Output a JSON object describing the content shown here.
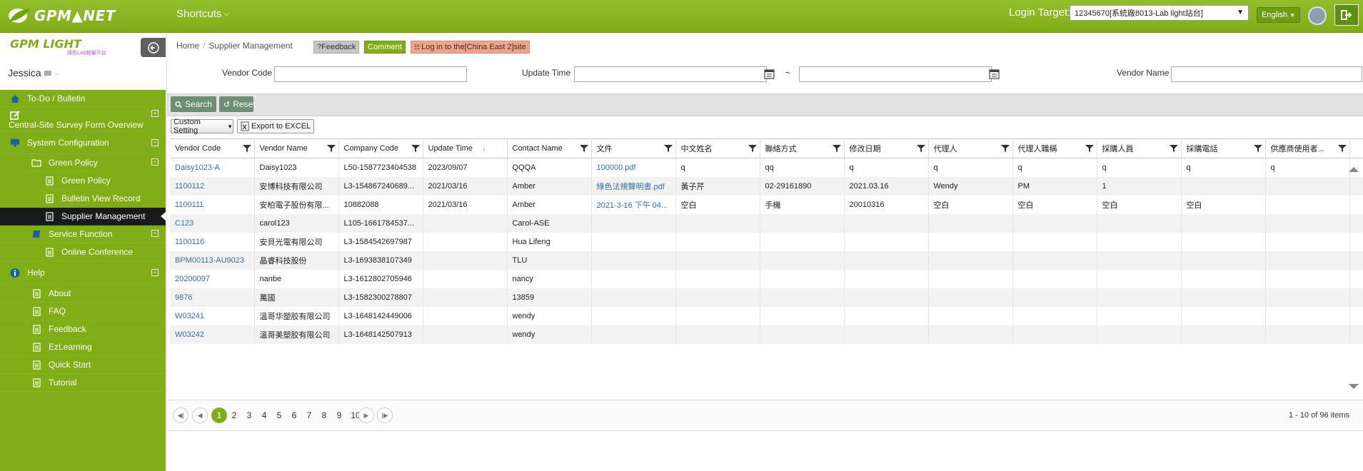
{
  "header": {
    "logo_text": "GPM▲NET",
    "shortcuts_label": "Shortcuts",
    "login_label": "Login Target:",
    "login_value": "12345670[系統廠8013-Lab light站台]",
    "language": "English"
  },
  "sidebar": {
    "logo_text": "GPM LIGHT",
    "logo_sub": "綠色Lab輕量平台",
    "user": "Jessica",
    "items": [
      {
        "label": "To-Do / Bulletin",
        "icon": "home-icon"
      },
      {
        "label": "Central-Site Survey Form Overview",
        "icon": "edit-icon"
      },
      {
        "label": "System Configuration",
        "icon": "monitor-icon"
      },
      {
        "label": "Green Policy",
        "icon": "folder-icon"
      },
      {
        "label": "Green Policy",
        "icon": "document-icon"
      },
      {
        "label": "Bulletin View Record",
        "icon": "document-icon"
      },
      {
        "label": "Supplier Management",
        "icon": "document-icon"
      },
      {
        "label": "Service Function",
        "icon": "book-icon"
      },
      {
        "label": "Online Conference",
        "icon": "document-icon"
      },
      {
        "label": "Help",
        "icon": "info-icon"
      },
      {
        "label": "About",
        "icon": "document-icon"
      },
      {
        "label": "FAQ",
        "icon": "document-icon"
      },
      {
        "label": "Feedback",
        "icon": "document-icon"
      },
      {
        "label": "EzLearning",
        "icon": "document-icon"
      },
      {
        "label": "Quick Start",
        "icon": "document-icon"
      },
      {
        "label": "Tutorial",
        "icon": "document-icon"
      }
    ]
  },
  "breadcrumb": {
    "home": "Home",
    "current": "Supplier Management"
  },
  "tags": {
    "feedback": "?Feedback",
    "comment": "Comment",
    "login_site": "Log in to the[China East 2]site"
  },
  "filters": {
    "vendor_code_label": "Vendor Code",
    "update_time_label": "Update Time",
    "range_sep": "~",
    "vendor_name_label": "Vendor Name"
  },
  "buttons": {
    "search": "Search",
    "reset": "Reset",
    "custom_setting": "Custom Setting",
    "export": "Export to EXCEL"
  },
  "table": {
    "columns": [
      "Vendor Code",
      "Vendor Name",
      "Company Code",
      "Update Time",
      "Contact Name",
      "文件",
      "中文姓名",
      "聯絡方式",
      "修改日期",
      "代理人",
      "代理人職稱",
      "採購人員",
      "採購電話",
      "供應商使用者..."
    ],
    "rows": [
      [
        "Daisy1023-A",
        "Daisy1023",
        "L50-1587723404538",
        "2023/09/07",
        "QQQA",
        "100000.pdf",
        "q",
        "qq",
        "q",
        "q",
        "q",
        "q",
        "q",
        "q"
      ],
      [
        "1100112",
        "安博科技有限公司",
        "L3-154867240689...",
        "2021/03/16",
        "Amber",
        "綠色法規聲明書.pdf",
        "黃子芹",
        "02-29161890",
        "2021.03.16",
        "Wendy",
        "PM",
        "1",
        "",
        ""
      ],
      [
        "1100111",
        "安柏電子股份有限...",
        "10882088",
        "2021/03/16",
        "Amber",
        "2021-3-16 下午 04...",
        "空白",
        "手機",
        "20010316",
        "空白",
        "空白",
        "空白",
        "空白",
        ""
      ],
      [
        "C123",
        "carol123",
        "L105-1661784537...",
        "",
        "Carol-ASE",
        "",
        "",
        "",
        "",
        "",
        "",
        "",
        "",
        ""
      ],
      [
        "1100116",
        "安貝光電有限公司",
        "L3-1584542697987",
        "",
        "Hua Lifeng",
        "",
        "",
        "",
        "",
        "",
        "",
        "",
        "",
        ""
      ],
      [
        "BPM00113-AU9023",
        "晶睿科技股份",
        "L3-1693838107349",
        "",
        "TLU",
        "",
        "",
        "",
        "",
        "",
        "",
        "",
        "",
        ""
      ],
      [
        "20200097",
        "nanbe",
        "L3-1612802705946",
        "",
        "nancy",
        "",
        "",
        "",
        "",
        "",
        "",
        "",
        "",
        ""
      ],
      [
        "9876",
        "萬國",
        "L3-1582300278807",
        "",
        "13859",
        "",
        "",
        "",
        "",
        "",
        "",
        "",
        "",
        ""
      ],
      [
        "W03241",
        "溫哥华塑胶有限公司",
        "L3-1648142449006",
        "",
        "wendy",
        "",
        "",
        "",
        "",
        "",
        "",
        "",
        "",
        ""
      ],
      [
        "W03242",
        "溫哥美塑胶有限公司",
        "L3-1648142507913",
        "",
        "wendy",
        "",
        "",
        "",
        "",
        "",
        "",
        "",
        "",
        ""
      ]
    ]
  },
  "pager": {
    "pages": [
      "1",
      "2",
      "3",
      "4",
      "5",
      "6",
      "7",
      "8",
      "9",
      "10"
    ],
    "current": "1",
    "info": "1 - 10 of 96 items"
  },
  "colors": {
    "brand": "#7fae17",
    "link": "#3570b0",
    "active_menu": "#1a1a1a"
  }
}
